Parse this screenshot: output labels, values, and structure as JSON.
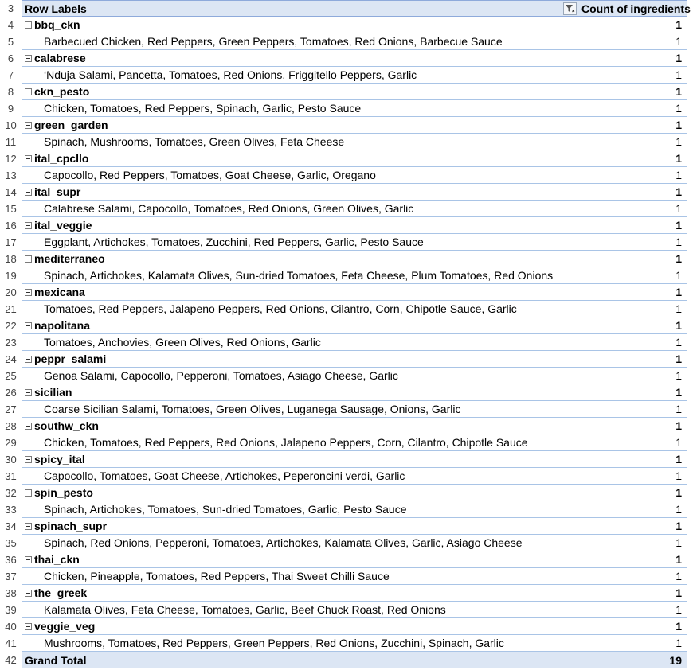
{
  "pivot": {
    "header": {
      "row_number": "3",
      "row_labels": "Row Labels",
      "value_header": "Count of ingredients",
      "filter_icon": "filter-dropdown-icon"
    },
    "rows": [
      {
        "num": "4",
        "type": "pizza",
        "label": "bbq_ckn",
        "count": "1"
      },
      {
        "num": "5",
        "type": "ingredient",
        "label": "Barbecued Chicken, Red Peppers, Green Peppers, Tomatoes, Red Onions, Barbecue Sauce",
        "count": "1"
      },
      {
        "num": "6",
        "type": "pizza",
        "label": "calabrese",
        "count": "1"
      },
      {
        "num": "7",
        "type": "ingredient",
        "label": "‘Nduja Salami, Pancetta, Tomatoes, Red Onions, Friggitello Peppers, Garlic",
        "count": "1"
      },
      {
        "num": "8",
        "type": "pizza",
        "label": "ckn_pesto",
        "count": "1"
      },
      {
        "num": "9",
        "type": "ingredient",
        "label": "Chicken, Tomatoes, Red Peppers, Spinach, Garlic, Pesto Sauce",
        "count": "1"
      },
      {
        "num": "10",
        "type": "pizza",
        "label": "green_garden",
        "count": "1"
      },
      {
        "num": "11",
        "type": "ingredient",
        "label": "Spinach, Mushrooms, Tomatoes, Green Olives, Feta Cheese",
        "count": "1"
      },
      {
        "num": "12",
        "type": "pizza",
        "label": "ital_cpcllo",
        "count": "1"
      },
      {
        "num": "13",
        "type": "ingredient",
        "label": "Capocollo, Red Peppers, Tomatoes, Goat Cheese, Garlic, Oregano",
        "count": "1"
      },
      {
        "num": "14",
        "type": "pizza",
        "label": "ital_supr",
        "count": "1"
      },
      {
        "num": "15",
        "type": "ingredient",
        "label": "Calabrese Salami, Capocollo, Tomatoes, Red Onions, Green Olives, Garlic",
        "count": "1"
      },
      {
        "num": "16",
        "type": "pizza",
        "label": "ital_veggie",
        "count": "1"
      },
      {
        "num": "17",
        "type": "ingredient",
        "label": "Eggplant, Artichokes, Tomatoes, Zucchini, Red Peppers, Garlic, Pesto Sauce",
        "count": "1"
      },
      {
        "num": "18",
        "type": "pizza",
        "label": "mediterraneo",
        "count": "1"
      },
      {
        "num": "19",
        "type": "ingredient",
        "label": "Spinach, Artichokes, Kalamata Olives, Sun-dried Tomatoes, Feta Cheese, Plum Tomatoes, Red Onions",
        "count": "1"
      },
      {
        "num": "20",
        "type": "pizza",
        "label": "mexicana",
        "count": "1"
      },
      {
        "num": "21",
        "type": "ingredient",
        "label": "Tomatoes, Red Peppers, Jalapeno Peppers, Red Onions, Cilantro, Corn, Chipotle Sauce, Garlic",
        "count": "1"
      },
      {
        "num": "22",
        "type": "pizza",
        "label": "napolitana",
        "count": "1"
      },
      {
        "num": "23",
        "type": "ingredient",
        "label": "Tomatoes, Anchovies, Green Olives, Red Onions, Garlic",
        "count": "1"
      },
      {
        "num": "24",
        "type": "pizza",
        "label": "peppr_salami",
        "count": "1"
      },
      {
        "num": "25",
        "type": "ingredient",
        "label": "Genoa Salami, Capocollo, Pepperoni, Tomatoes, Asiago Cheese, Garlic",
        "count": "1"
      },
      {
        "num": "26",
        "type": "pizza",
        "label": "sicilian",
        "count": "1"
      },
      {
        "num": "27",
        "type": "ingredient",
        "label": "Coarse Sicilian Salami, Tomatoes, Green Olives, Luganega Sausage, Onions, Garlic",
        "count": "1"
      },
      {
        "num": "28",
        "type": "pizza",
        "label": "southw_ckn",
        "count": "1"
      },
      {
        "num": "29",
        "type": "ingredient",
        "label": "Chicken, Tomatoes, Red Peppers, Red Onions, Jalapeno Peppers, Corn, Cilantro, Chipotle Sauce",
        "count": "1"
      },
      {
        "num": "30",
        "type": "pizza",
        "label": "spicy_ital",
        "count": "1"
      },
      {
        "num": "31",
        "type": "ingredient",
        "label": "Capocollo, Tomatoes, Goat Cheese, Artichokes, Peperoncini verdi, Garlic",
        "count": "1"
      },
      {
        "num": "32",
        "type": "pizza",
        "label": "spin_pesto",
        "count": "1"
      },
      {
        "num": "33",
        "type": "ingredient",
        "label": "Spinach, Artichokes, Tomatoes, Sun-dried Tomatoes, Garlic, Pesto Sauce",
        "count": "1"
      },
      {
        "num": "34",
        "type": "pizza",
        "label": "spinach_supr",
        "count": "1"
      },
      {
        "num": "35",
        "type": "ingredient",
        "label": "Spinach, Red Onions, Pepperoni, Tomatoes, Artichokes, Kalamata Olives, Garlic, Asiago Cheese",
        "count": "1"
      },
      {
        "num": "36",
        "type": "pizza",
        "label": "thai_ckn",
        "count": "1"
      },
      {
        "num": "37",
        "type": "ingredient",
        "label": "Chicken, Pineapple, Tomatoes, Red Peppers, Thai Sweet Chilli Sauce",
        "count": "1"
      },
      {
        "num": "38",
        "type": "pizza",
        "label": "the_greek",
        "count": "1"
      },
      {
        "num": "39",
        "type": "ingredient",
        "label": "Kalamata Olives, Feta Cheese, Tomatoes, Garlic, Beef Chuck Roast, Red Onions",
        "count": "1"
      },
      {
        "num": "40",
        "type": "pizza",
        "label": "veggie_veg",
        "count": "1"
      },
      {
        "num": "41",
        "type": "ingredient",
        "label": "Mushrooms, Tomatoes, Red Peppers, Green Peppers, Red Onions, Zucchini, Spinach, Garlic",
        "count": "1"
      }
    ],
    "total": {
      "num": "42",
      "label": "Grand Total",
      "count": "19"
    }
  },
  "colors": {
    "header_fill": "#dce6f4",
    "row_border": "#a9c4e6",
    "header_border": "#8eaadb"
  }
}
